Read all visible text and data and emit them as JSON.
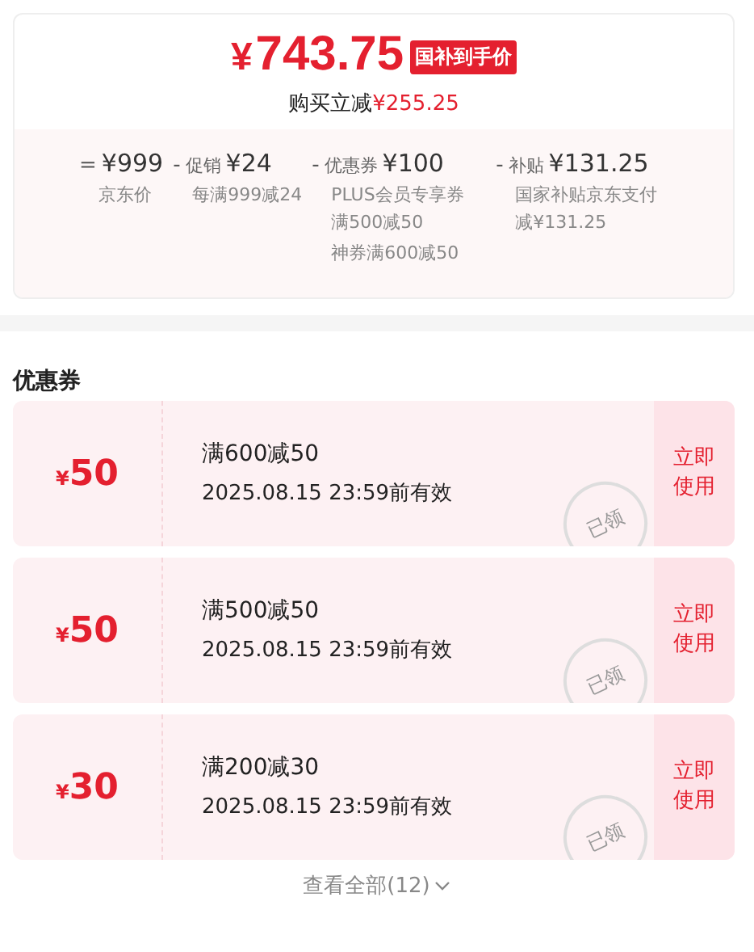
{
  "price": {
    "amount": "743.75",
    "currency": "¥",
    "badge": "国补到手价",
    "discount_label": "购买立减",
    "discount_amount": "¥255.25"
  },
  "breakdown": [
    {
      "op": "=",
      "amount": "¥999",
      "notes": [
        "京东价"
      ]
    },
    {
      "op": "-",
      "label": "促销",
      "amount": "¥24",
      "notes": [
        "每满999减24"
      ]
    },
    {
      "op": "-",
      "label": "优惠券",
      "amount": "¥100",
      "notes": [
        "PLUS会员专享券满500减50",
        "神券满600减50"
      ]
    },
    {
      "op": "-",
      "label": "补贴",
      "amount": "¥131.25",
      "notes": [
        "国家补贴京东支付减¥131.25"
      ]
    }
  ],
  "coupons_title": "优惠券",
  "coupons": [
    {
      "currency": "¥",
      "value": "50",
      "condition": "满600减50",
      "validity": "2025.08.15 23:59前有效",
      "stamp": "已领",
      "action": "立即使用"
    },
    {
      "currency": "¥",
      "value": "50",
      "condition": "满500减50",
      "validity": "2025.08.15 23:59前有效",
      "stamp": "已领",
      "action": "立即使用"
    },
    {
      "currency": "¥",
      "value": "30",
      "condition": "满200减30",
      "validity": "2025.08.15 23:59前有效",
      "stamp": "已领",
      "action": "立即使用"
    }
  ],
  "view_all": "查看全部(12)"
}
